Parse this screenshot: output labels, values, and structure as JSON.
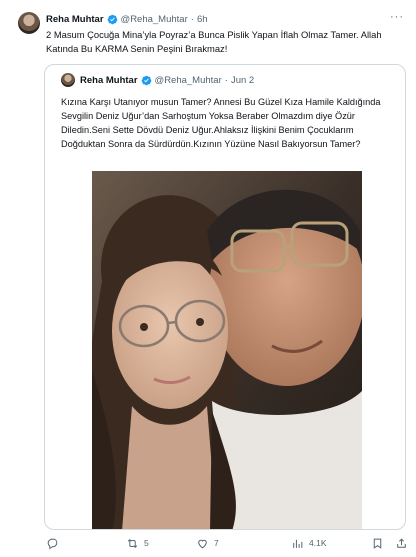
{
  "tweet": {
    "author_name": "Reha Muhtar",
    "handle": "@Reha_Muhtar",
    "separator": "·",
    "time": "6h",
    "text": "2 Masum Çocuğa Mina’yla Poyraz’a Bunca Pislik Yapan İflah Olmaz Tamer. Allah Katında Bu KARMA Senin Peşini Bırakmaz!",
    "more_icon": "more-icon"
  },
  "quoted": {
    "author_name": "Reha Muhtar",
    "handle": "@Reha_Muhtar",
    "separator": "·",
    "time": "Jun 2",
    "text": "Kızına Karşı Utanıyor musun Tamer? Annesi Bu Güzel Kıza Hamile Kaldığında Sevgilin Deniz Uğur’dan Sarhoştum Yoksa Beraber Olmazdım diye Özür Diledin.Seni Sette Dövdü Deniz Uğur.Ahlaksız İlişkini Benim Çocuklarım Doğduktan Sonra da Sürdürdün.Kızının Yüzüne Nasıl Bakıyorsun Tamer?"
  },
  "actions": {
    "reply": {
      "icon": "reply-icon",
      "count": ""
    },
    "retweet": {
      "icon": "retweet-icon",
      "count": "5"
    },
    "like": {
      "icon": "heart-icon",
      "count": "7"
    },
    "views": {
      "icon": "views-icon",
      "count": "4.1K"
    },
    "bookmark": {
      "icon": "bookmark-icon"
    },
    "share": {
      "icon": "share-icon"
    }
  },
  "colors": {
    "verified": "#1d9bf0",
    "muted": "#536471",
    "text": "#0f1419",
    "border": "#cfd9de"
  }
}
